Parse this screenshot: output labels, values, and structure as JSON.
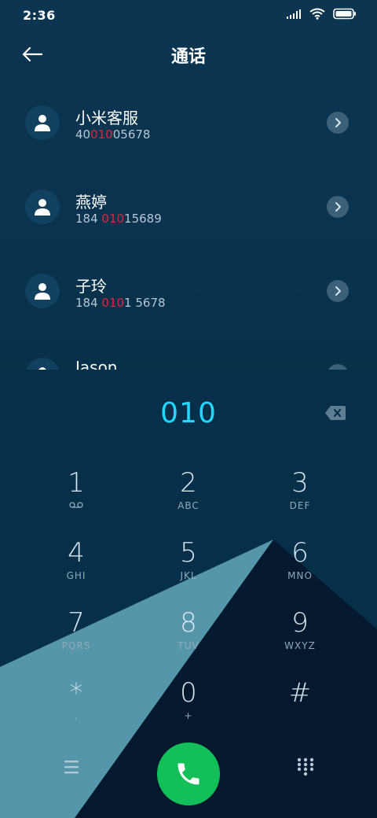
{
  "status_bar": {
    "time": "2:36"
  },
  "header": {
    "title": "通话"
  },
  "contacts": [
    {
      "name": "小米客服",
      "num_pre": "40",
      "num_hl": "010",
      "num_post": "05678"
    },
    {
      "name": "燕婷",
      "num_pre": "184 ",
      "num_hl": "010",
      "num_post": "15689"
    },
    {
      "name": "子玲",
      "num_pre": "184 ",
      "num_hl": "010",
      "num_post": "1 5678"
    },
    {
      "name": "Jason",
      "num_pre": "",
      "num_hl": "",
      "num_post": ""
    }
  ],
  "dial": {
    "input": "010"
  },
  "keypad": [
    {
      "digit": "1",
      "letters": ""
    },
    {
      "digit": "2",
      "letters": "ABC"
    },
    {
      "digit": "3",
      "letters": "DEF"
    },
    {
      "digit": "4",
      "letters": "GHI"
    },
    {
      "digit": "5",
      "letters": "JKL"
    },
    {
      "digit": "6",
      "letters": "MNO"
    },
    {
      "digit": "7",
      "letters": "PQRS"
    },
    {
      "digit": "8",
      "letters": "TUV"
    },
    {
      "digit": "9",
      "letters": "WXYZ"
    },
    {
      "digit": "*",
      "letters": ","
    },
    {
      "digit": "0",
      "letters": "+"
    },
    {
      "digit": "#",
      "letters": ""
    }
  ],
  "colors": {
    "accent": "#22d8ff",
    "match": "#e0243a",
    "call": "#12bf58"
  }
}
